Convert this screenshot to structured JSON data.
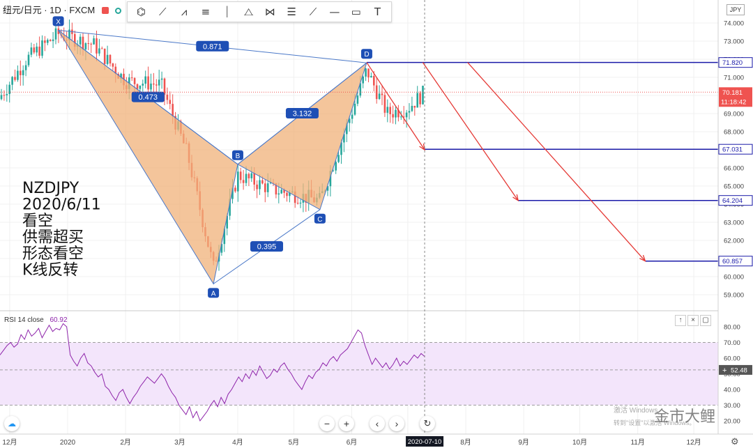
{
  "header": {
    "symbol": "纽元/日元 · 1D · FXCM",
    "currency_button": "JPY",
    "toolbar_icons": [
      "xabcd-pattern-icon",
      "path-icon",
      "elliott-wave-icon",
      "fib-retracement-icon",
      "vertical-line-icon",
      "triangle-pattern-icon",
      "abcd-pattern-icon",
      "fib-fan-icon",
      "trend-line-icon",
      "horizontal-line-icon",
      "rectangle-icon",
      "text-tool-icon"
    ]
  },
  "annotation": {
    "lines": [
      "NZDJPY",
      "2020/6/11",
      "看空",
      "供需超买",
      "形态看空",
      "K线反转"
    ]
  },
  "chart_data": [
    {
      "type": "candlestick",
      "symbol": "NZDJPY",
      "interval": "1D",
      "y_axis": {
        "range": [
          58.5,
          75
        ],
        "ticks": [
          "74.000",
          "73.000",
          "72.000",
          "71.000",
          "70.000",
          "69.000",
          "68.000",
          "67.000",
          "66.000",
          "65.000",
          "64.000",
          "63.000",
          "62.000",
          "61.000",
          "60.000",
          "59.000"
        ]
      },
      "x_axis": {
        "ticks": [
          "12月",
          "2020",
          "2月",
          "3月",
          "4月",
          "5月",
          "6月",
          "7",
          "8月",
          "9月",
          "10月",
          "11月",
          "12月"
        ],
        "cursor_date": "2020-07-10"
      },
      "pattern": {
        "name": "XABCD",
        "points": [
          {
            "label": "X",
            "x": "2019-12-27",
            "y": 73.6
          },
          {
            "label": "A",
            "x": "2020-03-19",
            "y": 59.6
          },
          {
            "label": "B",
            "x": "2020-04-01",
            "y": 66.2
          },
          {
            "label": "C",
            "x": "2020-05-15",
            "y": 63.7
          },
          {
            "label": "D",
            "x": "2020-06-09",
            "y": 71.8
          }
        ],
        "ratios": [
          {
            "label": "0.871",
            "between": [
              "X",
              "D"
            ]
          },
          {
            "label": "0.473",
            "between": [
              "X",
              "B"
            ]
          },
          {
            "label": "3.132",
            "between": [
              "B",
              "D"
            ]
          },
          {
            "label": "0.395",
            "between": [
              "A",
              "C"
            ]
          }
        ]
      },
      "levels": [
        {
          "price": 71.82,
          "label": "71.820",
          "color": "#1a1aa8"
        },
        {
          "price": 67.031,
          "label": "67.031",
          "color": "#1a1aa8"
        },
        {
          "price": 64.204,
          "label": "64.204",
          "color": "#1a1aa8"
        },
        {
          "price": 60.857,
          "label": "60.857",
          "color": "#1a1aa8"
        }
      ],
      "current_price": {
        "price": 70.181,
        "label": "70.181",
        "countdown": "11:18:42",
        "color": "#ef5350"
      },
      "arrows": [
        {
          "from": [
            "2020-06-09",
            71.82
          ],
          "to": [
            "2020-07-10",
            67.0
          ]
        },
        {
          "from": [
            "2020-07-09",
            71.82
          ],
          "to": [
            "2020-08-29",
            64.2
          ]
        },
        {
          "from": [
            "2020-08-02",
            71.82
          ],
          "to": [
            "2020-11-05",
            60.86
          ]
        }
      ],
      "colors": {
        "up": "#26a69a",
        "down": "#ef5350",
        "pattern_fill": "#f0b27a",
        "pattern_line": "#4a78c8",
        "level_line": "#1a1aa8",
        "arrow": "#e53935"
      }
    },
    {
      "type": "line",
      "title": "RSI 14 close",
      "current_value": "60.92",
      "y_axis": {
        "ticks": [
          "80.00",
          "70.00",
          "60.00",
          "50.00",
          "40.00",
          "30.00",
          "20.00"
        ]
      },
      "bands": {
        "upper": 70,
        "lower": 30,
        "color": "#f3e5fb"
      },
      "marker": {
        "value": 52.48,
        "label": "52.48"
      },
      "series": [
        {
          "values": [
            62,
            65,
            68,
            70,
            67,
            69,
            75,
            72,
            78,
            74,
            76,
            79,
            73,
            77,
            81,
            77,
            79,
            78,
            82,
            80,
            62,
            58,
            55,
            60,
            63,
            57,
            55,
            51,
            48,
            50,
            42,
            40,
            36,
            33,
            38,
            40,
            35,
            31,
            35,
            38,
            42,
            45,
            48,
            46,
            44,
            47,
            50,
            47,
            42,
            38,
            35,
            30,
            27,
            24,
            29,
            22,
            26,
            20,
            23,
            26,
            30,
            33,
            29,
            35,
            31,
            37,
            40,
            44,
            48,
            45,
            50,
            47,
            52,
            49,
            55,
            51,
            47,
            49,
            53,
            51,
            55,
            57,
            53,
            50,
            46,
            43,
            40,
            45,
            49,
            47,
            51,
            53,
            57,
            55,
            59,
            61,
            58,
            62,
            64,
            66,
            70,
            74,
            78,
            76,
            68,
            62,
            56,
            60,
            57,
            54,
            57,
            53,
            56,
            60,
            55,
            58,
            56,
            59,
            62,
            60,
            63,
            61
          ]
        }
      ],
      "colors": {
        "line": "#8e24aa",
        "dashed": "#9e9e9e"
      }
    }
  ],
  "bottom_controls": [
    "zoom-out-icon",
    "zoom-in-icon",
    "scroll-left-icon",
    "scroll-right-icon",
    "reset-icon"
  ],
  "right_panel_buttons": [
    "maximize-icon",
    "collapse-icon",
    "restore-icon"
  ],
  "watermark": {
    "brand": "金市大鲤",
    "small": "激活 Windows",
    "small2": "转到\"设置\"以激活 Windows。"
  },
  "settings": {
    "plus": "+"
  }
}
